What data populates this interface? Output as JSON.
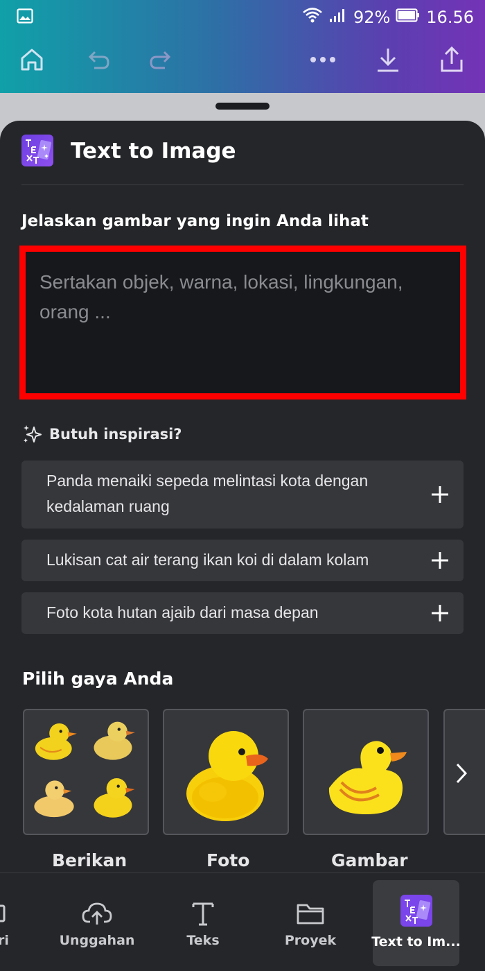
{
  "status_bar": {
    "battery": "92%",
    "time": "16.56"
  },
  "toolbar": {
    "icons": [
      "home-icon",
      "undo-icon",
      "redo-icon",
      "more-icon",
      "download-icon",
      "share-icon"
    ]
  },
  "panel": {
    "title": "Text to Image",
    "prompt_label": "Jelaskan gambar yang ingin Anda lihat",
    "prompt_placeholder": "Sertakan objek, warna, lokasi, lingkungan, orang ...",
    "prompt_value": "",
    "inspiration_label": "Butuh inspirasi?",
    "suggestions": [
      {
        "text": "Panda menaiki sepeda melintasi kota dengan kedalaman ruang"
      },
      {
        "text": "Lukisan cat air terang ikan koi di dalam kolam"
      },
      {
        "text": "Foto kota hutan ajaib dari masa depan"
      }
    ],
    "style_heading": "Pilih gaya Anda",
    "styles": [
      {
        "label": "Berikan"
      },
      {
        "label": "Foto"
      },
      {
        "label": "Gambar"
      }
    ]
  },
  "bottom_nav": {
    "items": [
      {
        "label": "ri"
      },
      {
        "label": "Unggahan"
      },
      {
        "label": "Teks"
      },
      {
        "label": "Proyek"
      },
      {
        "label": "Text to Im..."
      }
    ]
  },
  "colors": {
    "accent": "#7d4ff0",
    "highlight": "#ff0000",
    "panel": "#252629"
  }
}
